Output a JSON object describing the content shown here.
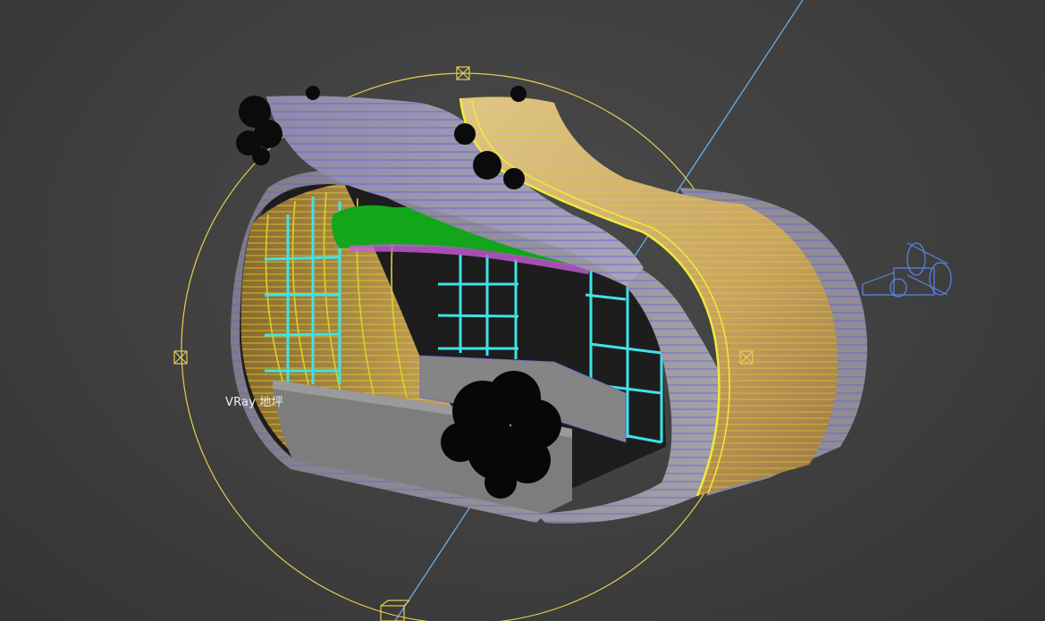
{
  "viewport": {
    "object_label": "VRay 地坪"
  },
  "colors": {
    "background": "#3f3f3f",
    "selection_wire": "#e3cf52",
    "wire_purple": "#6b5fd6",
    "wire_yellow": "#d9d22a",
    "mullion_cyan": "#3fe3e6",
    "foliage_green": "#13a51b",
    "planter_concrete": "#7a7a7a",
    "wood": "#c9a86a",
    "camera_blue": "#5a86e8",
    "axis_line": "#6fb6ef"
  },
  "icons": {
    "gizmo_handle": "box-handle-icon",
    "camera": "camera-icon"
  }
}
